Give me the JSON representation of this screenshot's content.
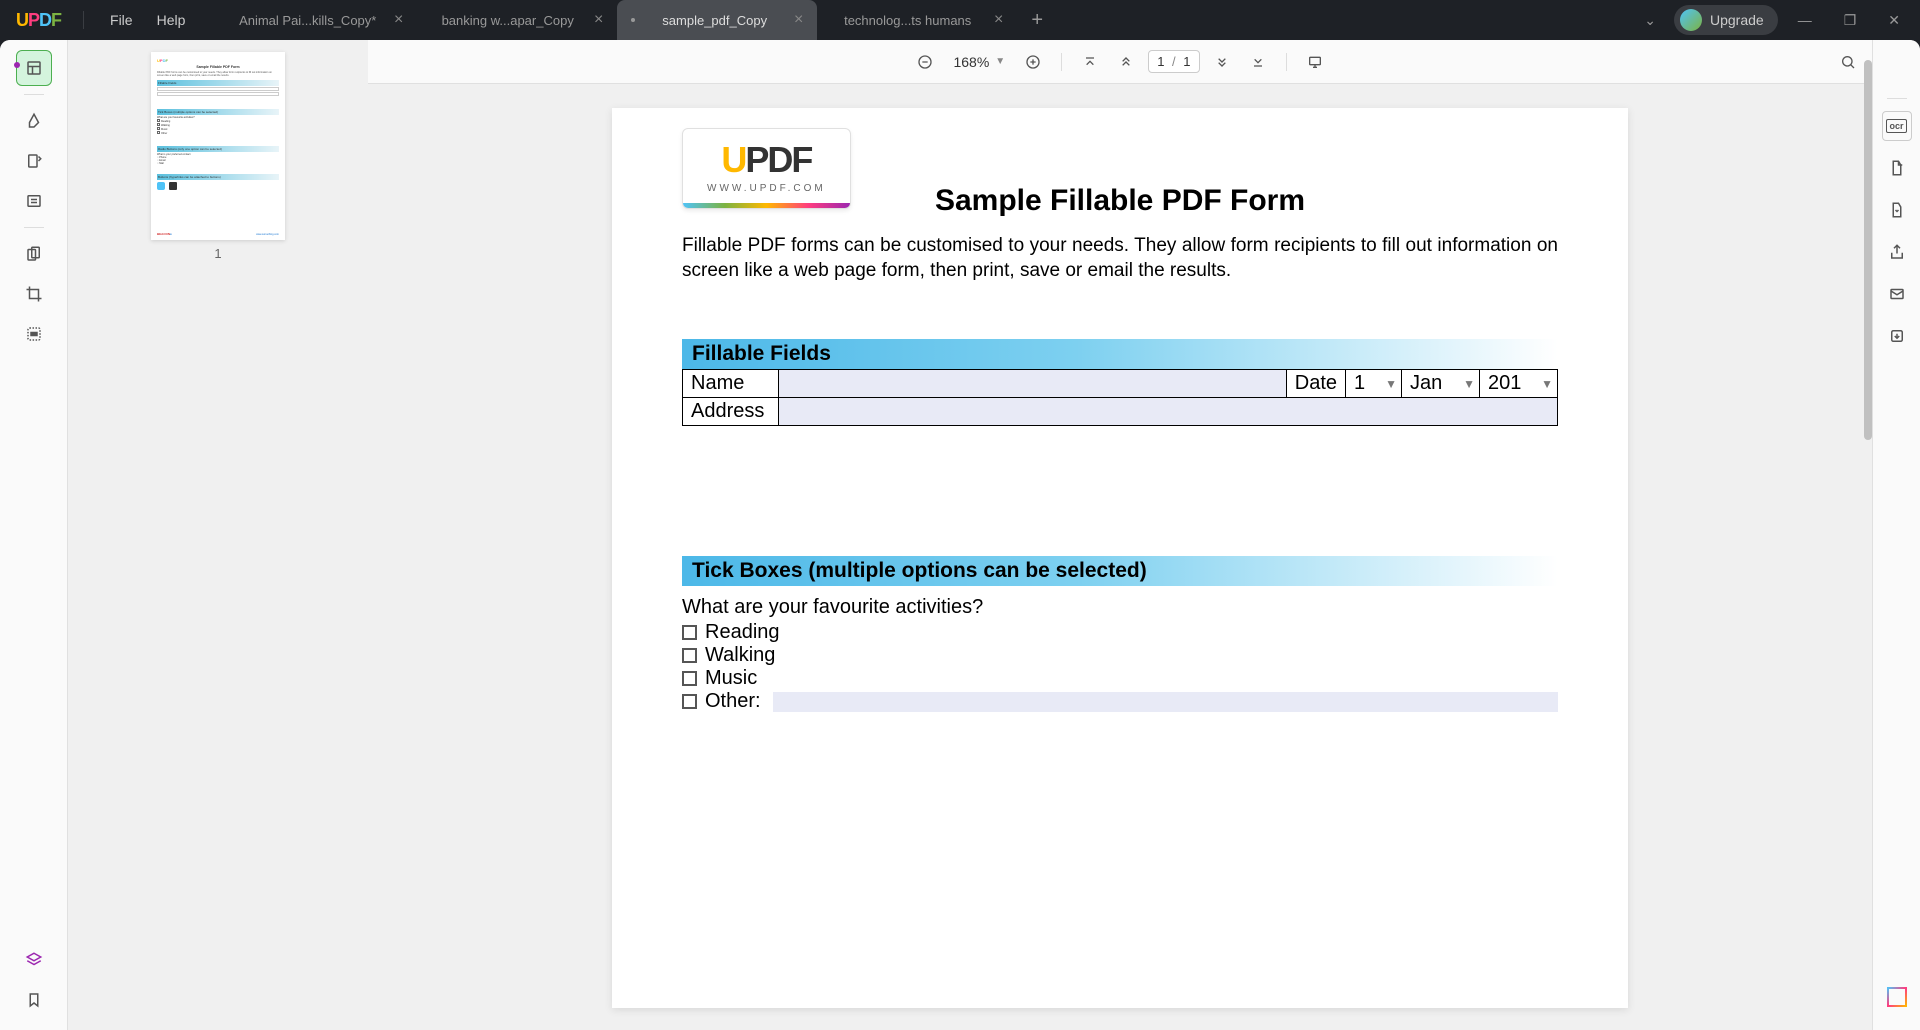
{
  "app": {
    "logo_letters": {
      "u": "U",
      "p": "P",
      "d": "D",
      "f": "F"
    },
    "url_text": "WWW.UPDF.COM"
  },
  "menu": {
    "file": "File",
    "help": "Help"
  },
  "tabs": [
    {
      "title": "Animal Pai...kills_Copy*",
      "active": false
    },
    {
      "title": "banking w...apar_Copy",
      "active": false
    },
    {
      "title": "sample_pdf_Copy",
      "active": true
    },
    {
      "title": "technolog...ts humans",
      "active": false
    }
  ],
  "titlebar": {
    "upgrade": "Upgrade"
  },
  "toolbar": {
    "zoom": "168%",
    "page_current": "1",
    "page_sep": "/",
    "page_total": "1"
  },
  "thumbnail": {
    "page_num": "1"
  },
  "document": {
    "title": "Sample Fillable PDF Form",
    "intro": "Fillable PDF forms can be customised to your needs. They allow form recipients to fill out information on screen like a web page form, then print, save or email the results.",
    "section1": {
      "header": "Fillable Fields",
      "name_label": "Name",
      "name_value": "",
      "date_label": "Date",
      "day": "1",
      "month": "Jan",
      "year": "201",
      "address_label": "Address",
      "address_value": ""
    },
    "section2": {
      "header": "Tick Boxes (multiple options can be selected)",
      "question": "What are your favourite activities?",
      "options": [
        "Reading",
        "Walking",
        "Music",
        "Other:"
      ]
    }
  }
}
